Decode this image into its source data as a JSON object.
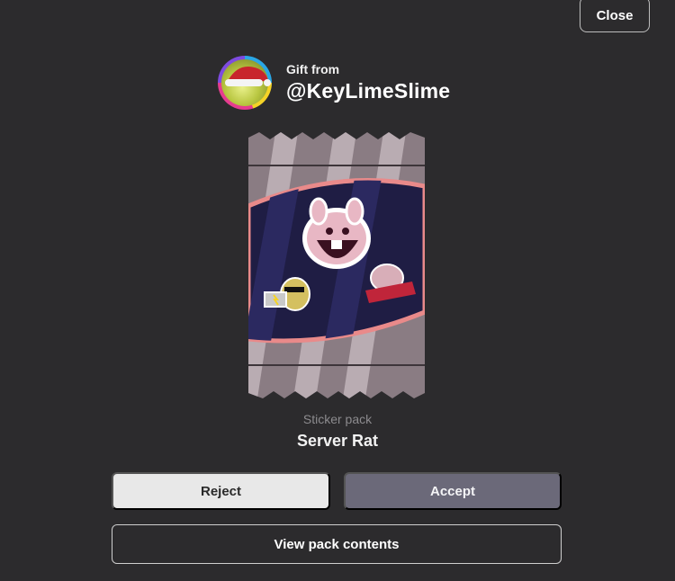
{
  "close_label": "Close",
  "sender": {
    "gift_from_label": "Gift from",
    "username": "@KeyLimeSlime"
  },
  "pack": {
    "type_label": "Sticker pack",
    "name": "Server Rat"
  },
  "actions": {
    "reject_label": "Reject",
    "accept_label": "Accept",
    "view_contents_label": "View pack contents"
  },
  "colors": {
    "background": "#2c2b2d",
    "accept_button": "#6b6979",
    "reject_button": "#e8e8e8"
  }
}
